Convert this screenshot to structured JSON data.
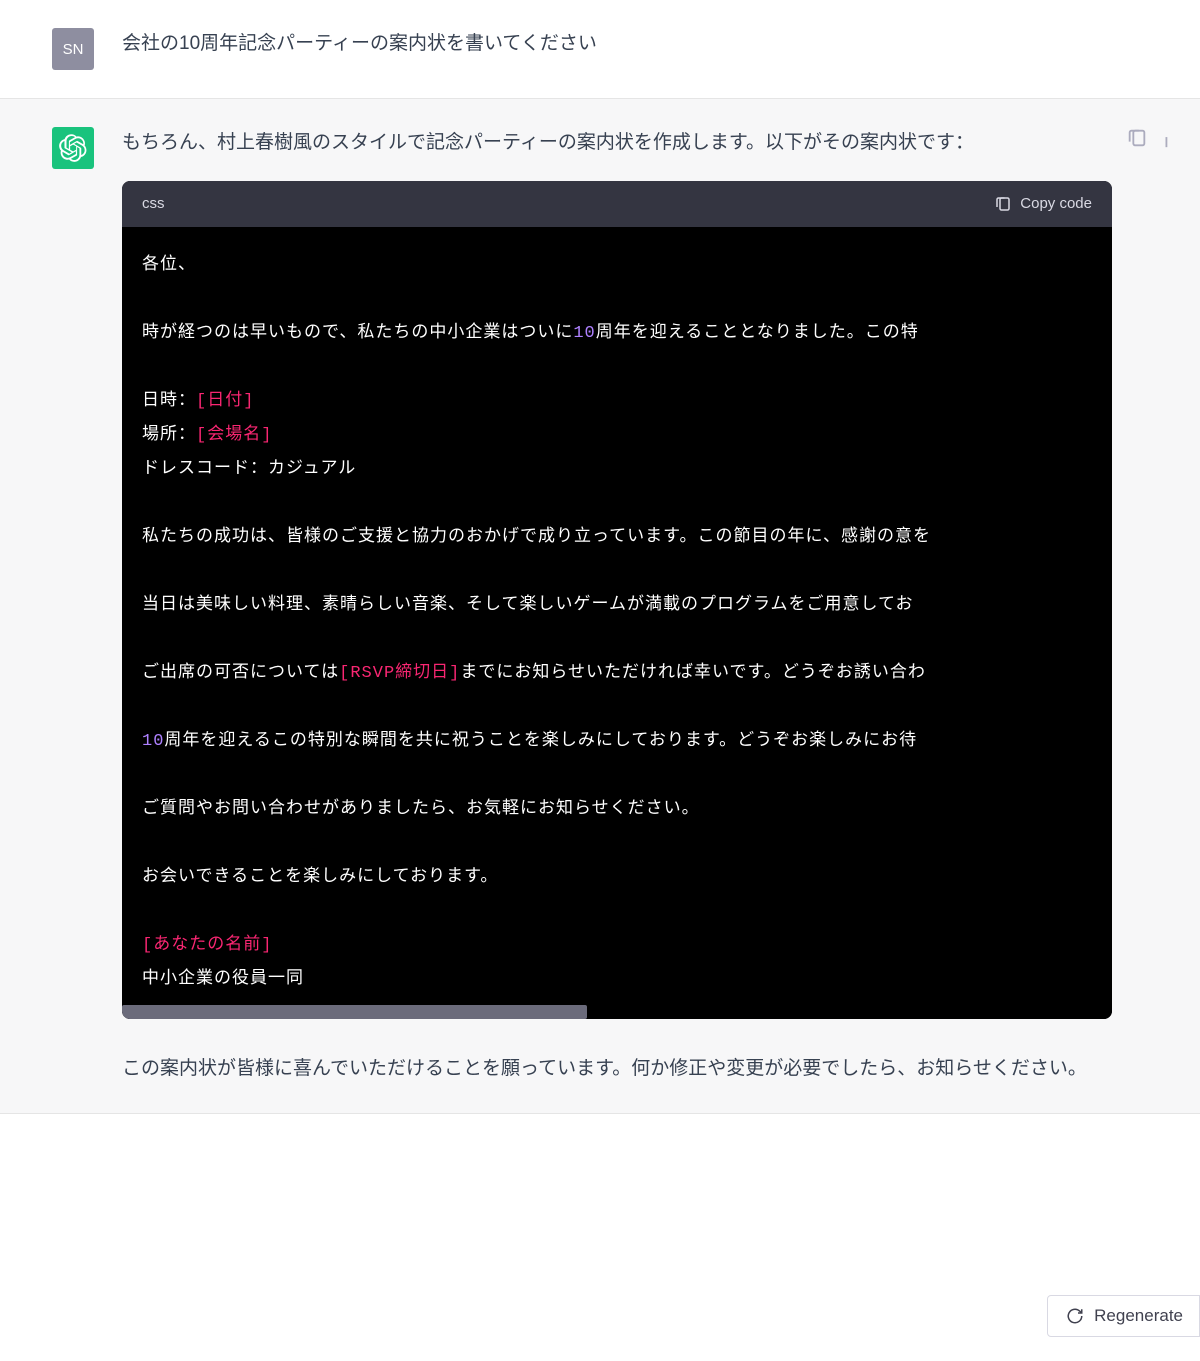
{
  "user": {
    "avatar_initials": "SN",
    "message": "会社の10周年記念パーティーの案内状を書いてください"
  },
  "assistant": {
    "intro": "もちろん、村上春樹風のスタイルで記念パーティーの案内状を作成します。以下がその案内状です：",
    "code_lang": "css",
    "copy_label": "Copy code",
    "code": {
      "line_salutation": "各位、",
      "line_body1_a": "時が経つのは早いもので、私たちの中小企業はついに",
      "line_body1_num": "10",
      "line_body1_b": "周年を迎えることとなりました。この特",
      "line_date_label": "日時：",
      "line_date_ph": "[日付]",
      "line_venue_label": "場所：",
      "line_venue_ph": "[会場名]",
      "line_dress": "ドレスコード：カジュアル",
      "line_body2": "私たちの成功は、皆様のご支援と協力のおかげで成り立っています。この節目の年に、感謝の意を",
      "line_body3": "当日は美味しい料理、素晴らしい音楽、そして楽しいゲームが満載のプログラムをご用意してお",
      "line_body4_a": "ご出席の可否については",
      "line_body4_ph": "[RSVP締切日]",
      "line_body4_b": "までにお知らせいただければ幸いです。どうぞお誘い合わ",
      "line_body5_num": "10",
      "line_body5_b": "周年を迎えるこの特別な瞬間を共に祝うことを楽しみにしております。どうぞお楽しみにお待",
      "line_body6": "ご質問やお問い合わせがありましたら、お気軽にお知らせください。",
      "line_body7": "お会いできることを楽しみにしております。",
      "line_sig_ph": "[あなたの名前]",
      "line_sig2": "中小企業の役員一同"
    },
    "closing": "この案内状が皆様に喜んでいただけることを願っています。何か修正や変更が必要でしたら、お知らせください。"
  },
  "regenerate_label": "Regenerate"
}
